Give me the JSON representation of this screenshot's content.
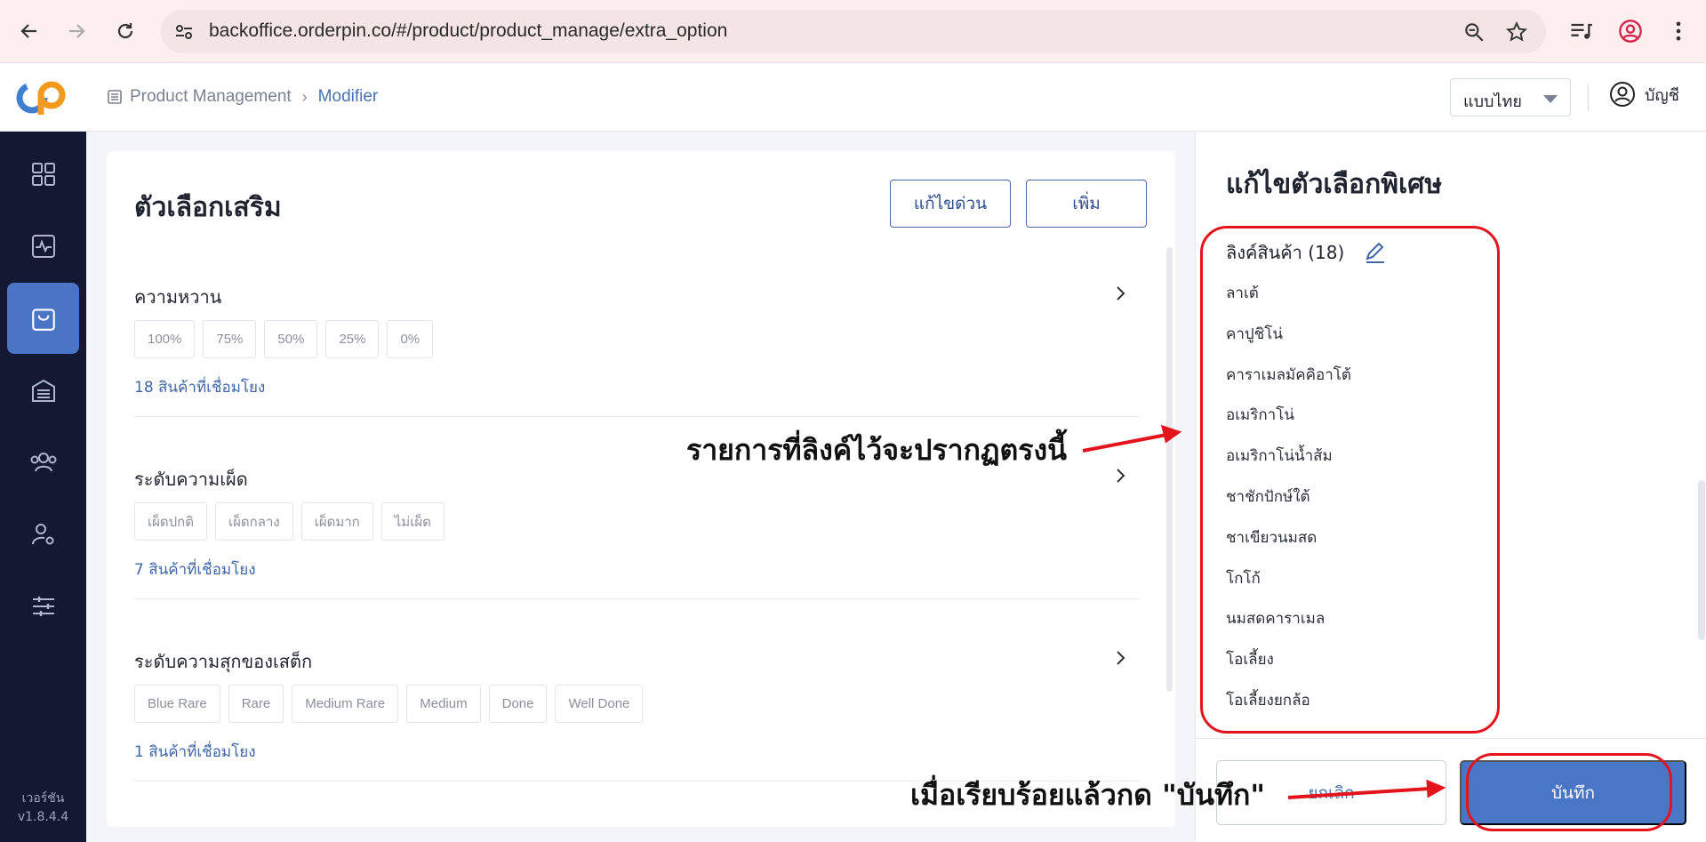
{
  "browser": {
    "url": "backoffice.orderpin.co/#/product/product_manage/extra_option"
  },
  "header": {
    "breadcrumb": [
      "Product Management",
      "Modifier"
    ],
    "language": "แบบไทย",
    "account_label": "บัญชี"
  },
  "sidebar": {
    "items": [
      "dashboard-icon",
      "activity-icon",
      "shopping-bag-icon",
      "warehouse-icon",
      "users-icon",
      "user-settings-icon",
      "sliders-icon"
    ],
    "active_index": 2,
    "version_label": "เวอร์ชัน",
    "version": "v1.8.4.4"
  },
  "main": {
    "title": "ตัวเลือกเสริม",
    "quick_edit_label": "แก้ไขด่วน",
    "add_label": "เพิ่ม",
    "groups": [
      {
        "title": "ความหวาน",
        "options": [
          "100%",
          "75%",
          "50%",
          "25%",
          "0%"
        ],
        "linked": "18 สินค้าที่เชื่อมโยง"
      },
      {
        "title": "ระดับความเผ็ด",
        "options": [
          "เผ็ดปกติ",
          "เผ็ดกลาง",
          "เผ็ดมาก",
          "ไม่เผ็ด"
        ],
        "linked": "7 สินค้าที่เชื่อมโยง"
      },
      {
        "title": "ระดับความสุกของเสต็ก",
        "options": [
          "Blue Rare",
          "Rare",
          "Medium Rare",
          "Medium",
          "Done",
          "Well Done"
        ],
        "linked": "1 สินค้าที่เชื่อมโยง"
      }
    ]
  },
  "panel": {
    "title": "แก้ไขตัวเลือกพิเศษ",
    "linked_heading": "ลิงค์สินค้า (18)",
    "products": [
      "ลาเต้",
      "คาปูชิโน่",
      "คาราเมลมัคคิอาโต้",
      "อเมริกาโน่",
      "อเมริกาโน่น้ำส้ม",
      "ชาชักปักษ์ใต้",
      "ชาเขียวนมสด",
      "โกโก้",
      "นมสดคาราเมล",
      "โอเลี้ยง",
      "โอเลี้ยงยกล้อ"
    ],
    "cancel_label": "ยกเลิก",
    "save_label": "บันทึก"
  },
  "annotations": {
    "list_note": "รายการที่ลิงค์ไว้จะปรากฏตรงนี้",
    "save_note": "เมื่อเรียบร้อยแล้วกด \"บันทึก\"",
    "color": "#e3141c"
  },
  "colors": {
    "sidebar_bg": "#151833",
    "accent": "#4a76c6",
    "link": "#3f67a8"
  }
}
